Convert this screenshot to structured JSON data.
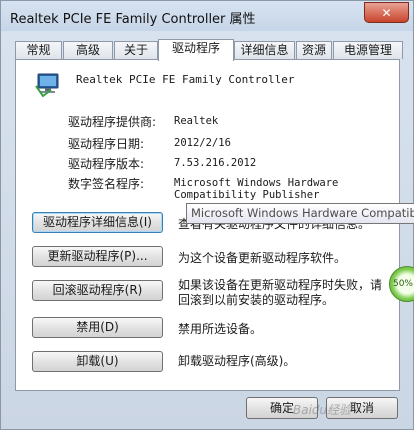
{
  "window": {
    "title": "Realtek PCIe FE Family Controller 属性",
    "close_symbol": "✕"
  },
  "tabs": [
    "常规",
    "高级",
    "关于",
    "驱动程序",
    "详细信息",
    "资源",
    "电源管理"
  ],
  "active_tab": "驱动程序",
  "device": {
    "name": "Realtek PCIe FE Family Controller",
    "icon": "network-adapter-icon"
  },
  "info": [
    {
      "label": "驱动程序提供商:",
      "value": "Realtek"
    },
    {
      "label": "驱动程序日期:",
      "value": "2012/2/16"
    },
    {
      "label": "驱动程序版本:",
      "value": "7.53.216.2012"
    },
    {
      "label": "数字签名程序:",
      "value": "Microsoft Windows Hardware",
      "value2": "Compatibility Publisher"
    }
  ],
  "actions": [
    {
      "button": "驱动程序详细信息(I)",
      "desc": "查看有关驱动程序文件的详细信息。"
    },
    {
      "button": "更新驱动程序(P)...",
      "desc": "为这个设备更新驱动程序软件。"
    },
    {
      "button": "回滚驱动程序(R)",
      "desc": "如果该设备在更新驱动程序时失败，请",
      "desc2": "回滚到以前安装的驱动程序。"
    },
    {
      "button": "禁用(D)",
      "desc": "禁用所选设备。"
    },
    {
      "button": "卸载(U)",
      "desc": "卸载驱动程序(高级)。"
    }
  ],
  "tooltip": "Microsoft Windows Hardware Compatibility Publisher",
  "progress_badge": "50%",
  "footer": {
    "ok": "确定",
    "cancel": "取消"
  },
  "watermark": "Baidu经验",
  "colors": {
    "focus": "#3c7fb1",
    "close": "#c8442d",
    "badge": "#7dcb4d"
  }
}
